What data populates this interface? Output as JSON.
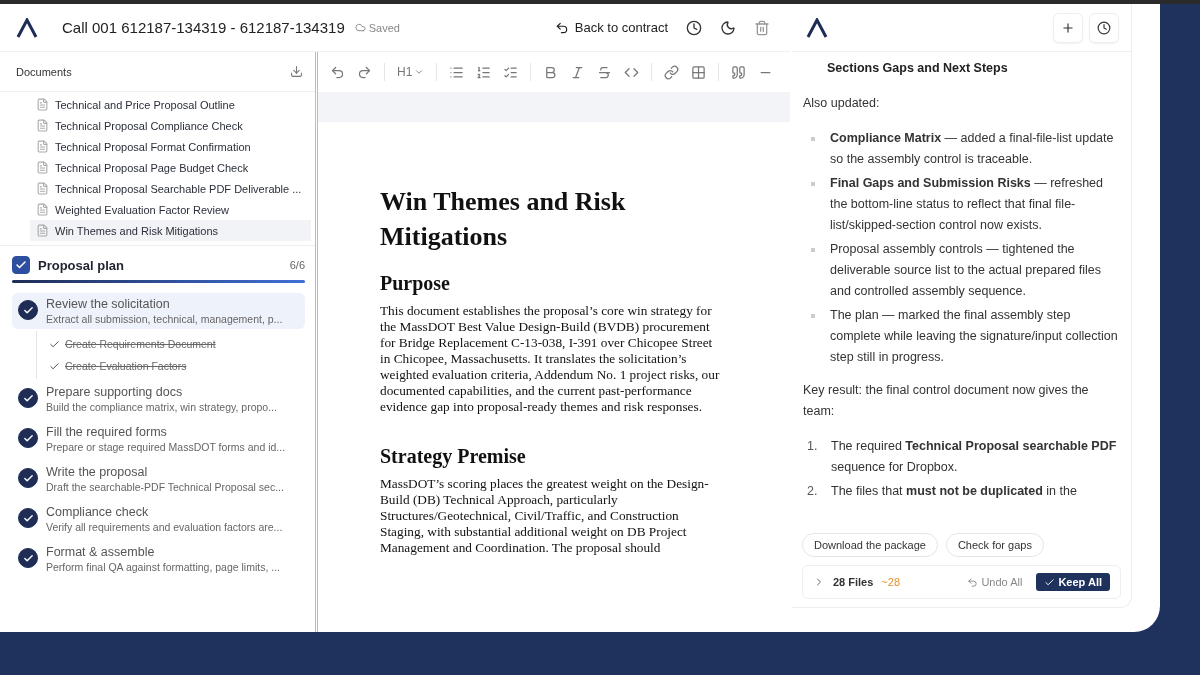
{
  "header": {
    "title": "Call 001 612187-134319 - 612187-134319",
    "saved": "Saved",
    "back": "Back to contract"
  },
  "documents": {
    "title": "Documents",
    "items": [
      {
        "label": "Technical and Price Proposal Outline",
        "selected": false
      },
      {
        "label": "Technical Proposal Compliance Check",
        "selected": false
      },
      {
        "label": "Technical Proposal Format Confirmation",
        "selected": false
      },
      {
        "label": "Technical Proposal Page Budget Check",
        "selected": false
      },
      {
        "label": "Technical Proposal Searchable PDF Deliverable ...",
        "selected": false
      },
      {
        "label": "Weighted Evaluation Factor Review",
        "selected": false
      },
      {
        "label": "Win Themes and Risk Mitigations",
        "selected": true
      }
    ]
  },
  "plan": {
    "title": "Proposal plan",
    "checked": true,
    "count": "6/6",
    "level": 1,
    "steps": [
      {
        "title": "Review the solicitation",
        "description": "Extract all submission, technical, management, p...",
        "done": true,
        "selected": true,
        "children": [
          {
            "label": "Create Requirements Document",
            "done": true
          },
          {
            "label": "Create Evaluation Factors",
            "done": true
          }
        ]
      },
      {
        "title": "Prepare supporting docs",
        "description": "Build the compliance matrix, win strategy, propo...",
        "done": true,
        "selected": false
      },
      {
        "title": "Fill the required forms",
        "description": "Prepare or stage required MassDOT forms and id...",
        "done": true,
        "selected": false
      },
      {
        "title": "Write the proposal",
        "description": "Draft the searchable-PDF Technical Proposal sec...",
        "done": true,
        "selected": false
      },
      {
        "title": "Compliance check",
        "description": "Verify all requirements and evaluation factors are...",
        "done": true,
        "selected": false
      },
      {
        "title": "Format & assemble",
        "description": "Perform final QA against formatting, page limits, ...",
        "done": true,
        "selected": false
      }
    ]
  },
  "toolbar": {
    "heading": "H1"
  },
  "document": {
    "title": "Win Themes and Risk Mitigations",
    "sections": [
      {
        "heading": "Purpose",
        "body": "This document establishes the proposal’s core win strategy for the MassDOT Best Value Design-Build (BVDB) procurement for Bridge Replacement C-13-038, I-391 over Chicopee Street in Chicopee, Massachusetts. It translates the solicitation’s weighted evaluation criteria, Addendum No. 1 project risks, our documented capabilities, and the current past-performance evidence gap into proposal-ready themes and risk responses."
      },
      {
        "heading": "Strategy Premise",
        "body": "MassDOT’s scoring places the greatest weight on the Design-Build (DB) Technical Approach, particularly Structures/Geotechnical, Civil/Traffic, and Construction Staging, with substantial additional weight on DB Project Management and Coordination. The proposal should"
      }
    ]
  },
  "assistant": {
    "blocks": [
      {
        "kind": "continuation",
        "text": "Sections Gaps and Next Steps"
      },
      {
        "kind": "paragraph",
        "text": "Also updated:"
      },
      {
        "kind": "bullets",
        "items": [
          "**Compliance Matrix** — added a final-file-list update so the assembly control is traceable.",
          "**Final Gaps and Submission Risks** — refreshed the bottom-line status to reflect that final file-list/skipped-section control now exists.",
          "Proposal assembly controls — tightened the deliverable source list to the actual prepared files and controlled assembly sequence.",
          "The plan — marked the final assembly step complete while leaving the signature/input collection step still in progress."
        ]
      },
      {
        "kind": "paragraph",
        "text": "Key result: the final control document now gives the team:"
      },
      {
        "kind": "numbered",
        "items": [
          {
            "number": "1.",
            "text": "The required **Technical Proposal searchable PDF** sequence for Dropbox."
          },
          {
            "number": "2.",
            "text": "The files that **must not be duplicated** in the"
          }
        ]
      }
    ],
    "actions": [
      "Download the package",
      "Check for gaps"
    ],
    "changes": {
      "files": "28 Files",
      "delta": "~28",
      "undo": "Undo All",
      "keep": "Keep All"
    }
  }
}
